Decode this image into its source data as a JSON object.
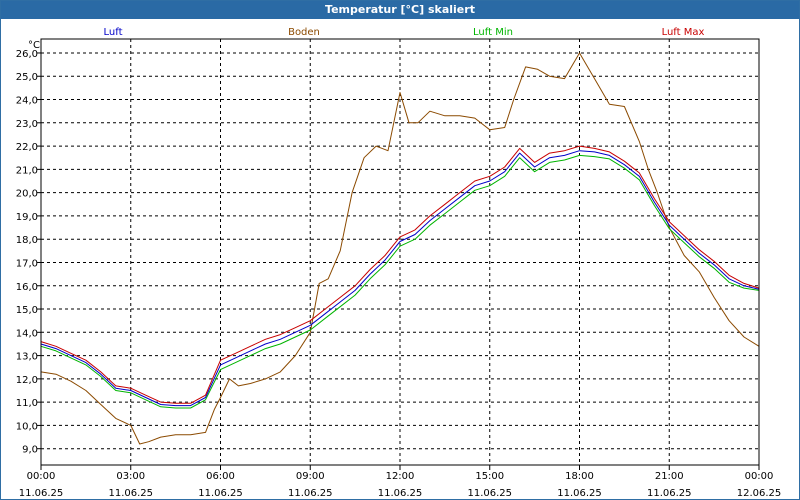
{
  "window": {
    "title": "Temperatur [°C] skaliert"
  },
  "colors": {
    "Luft": "#0000c8",
    "Boden": "#8b4a00",
    "Luft Min": "#00b400",
    "Luft Max": "#c80000",
    "grid": "#000000",
    "titlebar": "#2a6aa5"
  },
  "chart_data": {
    "type": "line",
    "title": "Temperatur [°C] skaliert",
    "ylabel": "°C",
    "xlabel": "",
    "ylim": [
      8.3,
      26.6
    ],
    "xlim": [
      0,
      24
    ],
    "y_ticks": [
      "9,0",
      "10,0",
      "11,0",
      "12,0",
      "13,0",
      "14,0",
      "15,0",
      "16,0",
      "17,0",
      "18,0",
      "19,0",
      "20,0",
      "21,0",
      "22,0",
      "23,0",
      "24,0",
      "25,0",
      "26,0"
    ],
    "y_tick_values": [
      9,
      10,
      11,
      12,
      13,
      14,
      15,
      16,
      17,
      18,
      19,
      20,
      21,
      22,
      23,
      24,
      25,
      26
    ],
    "x_ticks": [
      {
        "x": 0,
        "time": "00:00",
        "date": "11.06.25"
      },
      {
        "x": 3,
        "time": "03:00",
        "date": "11.06.25"
      },
      {
        "x": 6,
        "time": "06:00",
        "date": "11.06.25"
      },
      {
        "x": 9,
        "time": "09:00",
        "date": "11.06.25"
      },
      {
        "x": 12,
        "time": "12:00",
        "date": "11.06.25"
      },
      {
        "x": 15,
        "time": "15:00",
        "date": "11.06.25"
      },
      {
        "x": 18,
        "time": "18:00",
        "date": "11.06.25"
      },
      {
        "x": 21,
        "time": "21:00",
        "date": "11.06.25"
      },
      {
        "x": 24,
        "time": "00:00",
        "date": "12.06.25"
      }
    ],
    "grid": true,
    "legend_position": "top",
    "series": [
      {
        "name": "Luft",
        "x": [
          0,
          0.5,
          1,
          1.5,
          2,
          2.5,
          3,
          3.5,
          4,
          4.5,
          5,
          5.5,
          6,
          6.5,
          7,
          7.5,
          8,
          8.5,
          9,
          9.5,
          10,
          10.5,
          11,
          11.5,
          12,
          12.5,
          13,
          13.5,
          14,
          14.5,
          15,
          15.5,
          16,
          16.5,
          17,
          17.5,
          18,
          18.5,
          19,
          19.5,
          20,
          20.5,
          21,
          21.5,
          22,
          22.5,
          23,
          23.5,
          24
        ],
        "values": [
          13.5,
          13.3,
          13.0,
          12.7,
          12.2,
          11.6,
          11.5,
          11.2,
          10.9,
          10.85,
          10.85,
          11.2,
          12.6,
          12.9,
          13.2,
          13.5,
          13.7,
          14.0,
          14.3,
          14.8,
          15.3,
          15.8,
          16.5,
          17.1,
          17.9,
          18.2,
          18.8,
          19.3,
          19.8,
          20.3,
          20.5,
          20.9,
          21.7,
          21.1,
          21.5,
          21.6,
          21.8,
          21.75,
          21.6,
          21.2,
          20.7,
          19.6,
          18.6,
          18.0,
          17.4,
          16.9,
          16.3,
          16.0,
          15.85
        ]
      },
      {
        "name": "Boden",
        "x": [
          0,
          0.5,
          1,
          1.5,
          2,
          2.5,
          3,
          3.3,
          3.6,
          4,
          4.5,
          5,
          5.5,
          5.8,
          6,
          6.3,
          6.6,
          7,
          7.5,
          8,
          8.5,
          9,
          9.3,
          9.6,
          10,
          10.4,
          10.8,
          11.2,
          11.6,
          12,
          12.3,
          12.6,
          13,
          13.5,
          14,
          14.5,
          15,
          15.5,
          15.8,
          16.2,
          16.6,
          17,
          17.5,
          18,
          18.5,
          19,
          19.5,
          20,
          20.3,
          20.6,
          21,
          21.5,
          22,
          22.5,
          23,
          23.5,
          24
        ],
        "values": [
          12.3,
          12.2,
          11.9,
          11.5,
          10.9,
          10.3,
          10.0,
          9.2,
          9.3,
          9.5,
          9.6,
          9.6,
          9.7,
          10.7,
          11.2,
          12.0,
          11.7,
          11.8,
          12.0,
          12.3,
          13.0,
          14.0,
          16.1,
          16.3,
          17.5,
          20.0,
          21.5,
          22.0,
          21.8,
          24.3,
          23.0,
          23.0,
          23.5,
          23.3,
          23.3,
          23.2,
          22.7,
          22.8,
          24.0,
          25.4,
          25.3,
          25.0,
          24.9,
          26.0,
          24.9,
          23.8,
          23.7,
          22.2,
          21.0,
          20.0,
          18.5,
          17.3,
          16.6,
          15.5,
          14.5,
          13.8,
          13.4
        ]
      },
      {
        "name": "Luft Min",
        "x": [
          0,
          0.5,
          1,
          1.5,
          2,
          2.5,
          3,
          3.5,
          4,
          4.5,
          5,
          5.5,
          6,
          6.5,
          7,
          7.5,
          8,
          8.5,
          9,
          9.5,
          10,
          10.5,
          11,
          11.5,
          12,
          12.5,
          13,
          13.5,
          14,
          14.5,
          15,
          15.5,
          16,
          16.5,
          17,
          17.5,
          18,
          18.5,
          19,
          19.5,
          20,
          20.5,
          21,
          21.5,
          22,
          22.5,
          23,
          23.5,
          24
        ],
        "values": [
          13.4,
          13.2,
          12.9,
          12.6,
          12.1,
          11.5,
          11.4,
          11.1,
          10.8,
          10.75,
          10.75,
          11.1,
          12.4,
          12.7,
          13.0,
          13.3,
          13.5,
          13.8,
          14.1,
          14.6,
          15.1,
          15.6,
          16.3,
          16.9,
          17.7,
          18.0,
          18.6,
          19.1,
          19.6,
          20.1,
          20.3,
          20.7,
          21.5,
          20.9,
          21.3,
          21.4,
          21.6,
          21.55,
          21.45,
          21.05,
          20.55,
          19.45,
          18.45,
          17.85,
          17.25,
          16.75,
          16.15,
          15.9,
          15.8
        ]
      },
      {
        "name": "Luft Max",
        "x": [
          0,
          0.5,
          1,
          1.5,
          2,
          2.5,
          3,
          3.5,
          4,
          4.5,
          5,
          5.5,
          6,
          6.5,
          7,
          7.5,
          8,
          8.5,
          9,
          9.5,
          10,
          10.5,
          11,
          11.5,
          12,
          12.5,
          13,
          13.5,
          14,
          14.5,
          15,
          15.5,
          16,
          16.5,
          17,
          17.5,
          18,
          18.5,
          19,
          19.5,
          20,
          20.5,
          21,
          21.5,
          22,
          22.5,
          23,
          23.5,
          24
        ],
        "values": [
          13.6,
          13.4,
          13.1,
          12.8,
          12.3,
          11.7,
          11.6,
          11.3,
          11.0,
          10.95,
          10.95,
          11.3,
          12.8,
          13.1,
          13.4,
          13.7,
          13.9,
          14.2,
          14.5,
          15.0,
          15.5,
          16.0,
          16.7,
          17.3,
          18.1,
          18.4,
          19.0,
          19.5,
          20.0,
          20.5,
          20.7,
          21.1,
          21.9,
          21.3,
          21.7,
          21.8,
          22.0,
          21.9,
          21.75,
          21.35,
          20.85,
          19.75,
          18.75,
          18.15,
          17.55,
          17.05,
          16.45,
          16.1,
          15.9
        ]
      }
    ]
  }
}
